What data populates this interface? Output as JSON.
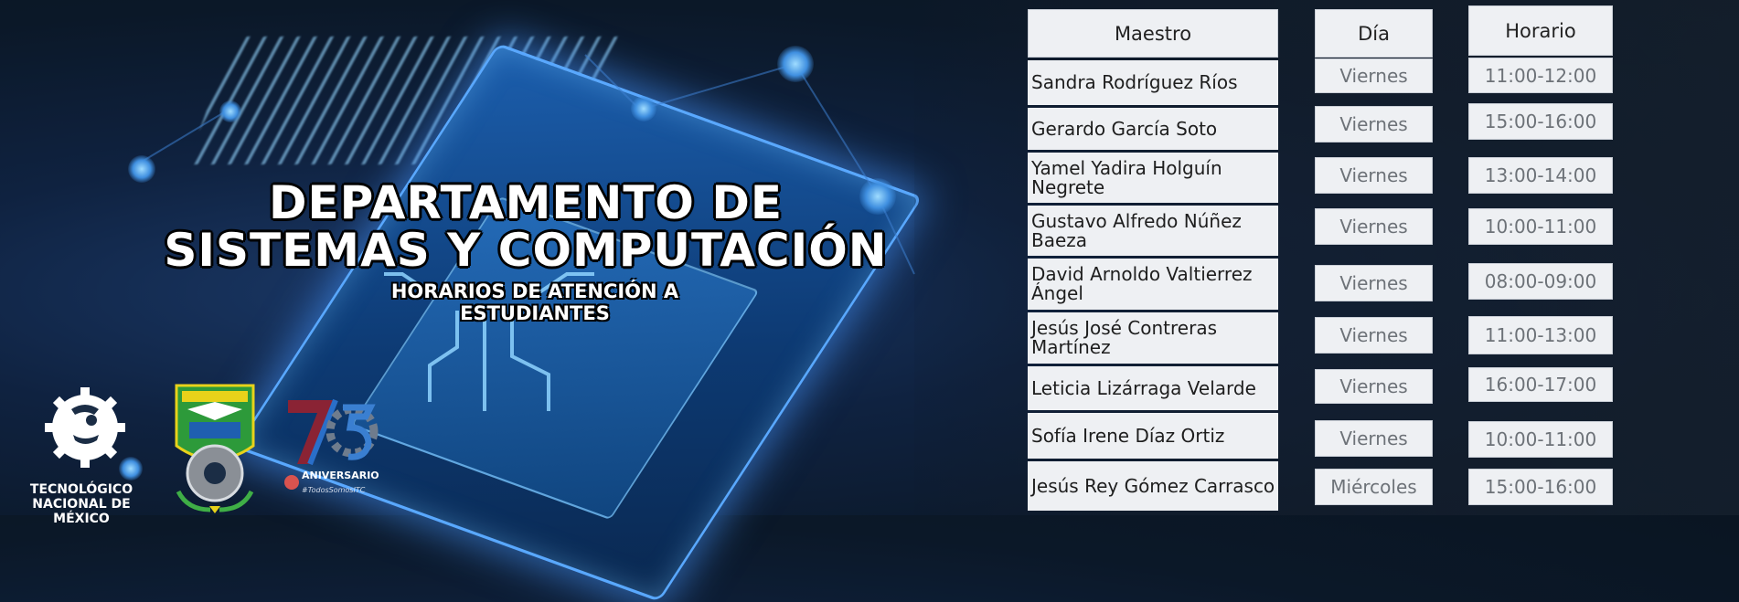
{
  "header": {
    "title_line1": "DEPARTAMENTO DE",
    "title_line2": "SISTEMAS Y COMPUTACIÓN",
    "subtitle_line1": "HORARIOS DE ATENCIÓN  A",
    "subtitle_line2": "ESTUDIANTES"
  },
  "logos": {
    "tec_line1": "TECNOLÓGICO",
    "tec_line2": "NACIONAL DE MÉXICO",
    "anniversary_text": "ANIVERSARIO",
    "anniversary_tag": "#TodosSomosITC"
  },
  "table": {
    "headers": {
      "teacher": "Maestro",
      "day": "Día",
      "time": "Horario"
    },
    "rows": [
      {
        "teacher": "Sandra Rodríguez Ríos",
        "day": "Viernes",
        "time": "11:00-12:00"
      },
      {
        "teacher": "Gerardo García Soto",
        "day": "Viernes",
        "time": "15:00-16:00"
      },
      {
        "teacher": "Yamel Yadira Holguín Negrete",
        "day": "Viernes",
        "time": "13:00-14:00"
      },
      {
        "teacher": "Gustavo Alfredo Núñez Baeza",
        "day": "Viernes",
        "time": "10:00-11:00"
      },
      {
        "teacher": "David Arnoldo Valtierrez Ángel",
        "day": "Viernes",
        "time": "08:00-09:00"
      },
      {
        "teacher": "Jesús José Contreras Martínez",
        "day": "Viernes",
        "time": "11:00-13:00"
      },
      {
        "teacher": "Leticia Lizárraga Velarde",
        "day": "Viernes",
        "time": "16:00-17:00"
      },
      {
        "teacher": "Sofía Irene Díaz Ortiz",
        "day": "Viernes",
        "time": "10:00-11:00"
      },
      {
        "teacher": "Jesús Rey Gómez Carrasco",
        "day": "Miércoles",
        "time": "15:00-16:00"
      }
    ]
  },
  "colors": {
    "background": "#0f2240",
    "cell": "#eef0f3",
    "accent_glow": "#59a8ff"
  }
}
